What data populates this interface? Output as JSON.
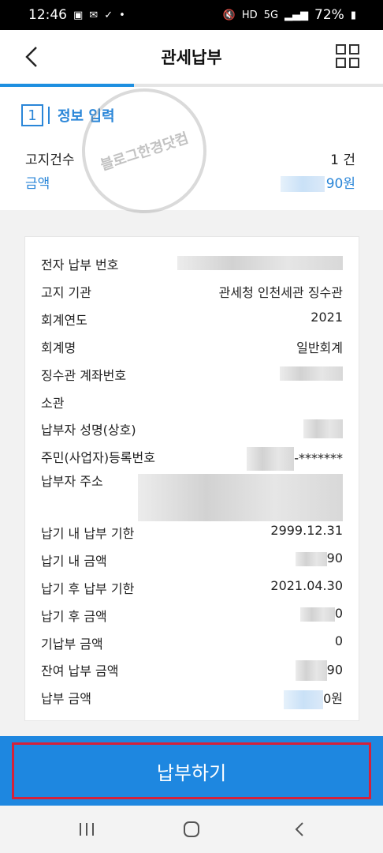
{
  "status_bar": {
    "time": "12:46",
    "battery": "72%"
  },
  "header": {
    "title": "관세납부"
  },
  "progress": {
    "fraction": 0.35
  },
  "step": {
    "number": "1",
    "label": "정보 입력"
  },
  "summary": {
    "count_label": "고지건수",
    "count_value": "1 건",
    "amount_label": "금액",
    "amount_value": "90원"
  },
  "watermark": {
    "text": "블로그한경닷컴"
  },
  "details": [
    {
      "label": "전자 납부 번호",
      "value": ""
    },
    {
      "label": "고지 기관",
      "value": "관세청 인천세관 징수관"
    },
    {
      "label": "회계연도",
      "value": "2021"
    },
    {
      "label": "회계명",
      "value": "일반회계"
    },
    {
      "label": "징수관 계좌번호",
      "value": ""
    },
    {
      "label": "소관",
      "value": ""
    },
    {
      "label": "납부자 성명(상호)",
      "value": ""
    },
    {
      "label": "주민(사업자)등록번호",
      "value": "-*******"
    },
    {
      "label": "납부자 주소",
      "value": ""
    },
    {
      "label": "납기 내 납부 기한",
      "value": "2999.12.31"
    },
    {
      "label": "납기 내 금액",
      "value": "90"
    },
    {
      "label": "납기 후 납부 기한",
      "value": "2021.04.30"
    },
    {
      "label": "납기 후 금액",
      "value": "0"
    },
    {
      "label": "기납부 금액",
      "value": "0"
    },
    {
      "label": "잔여 납부 금액",
      "value": "90"
    },
    {
      "label": "납부 금액",
      "value": "0원"
    }
  ],
  "submit": {
    "label": "납부하기"
  },
  "colors": {
    "accent": "#1e87e0",
    "highlight": "#d5213a"
  }
}
